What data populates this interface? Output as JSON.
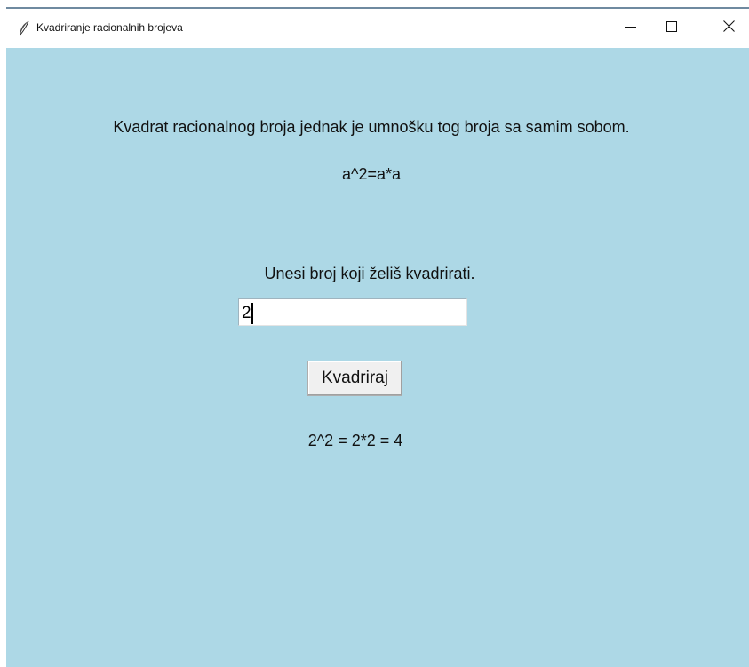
{
  "window": {
    "title": "Kvadriranje racionalnih brojeva",
    "icon": "feather-icon",
    "controls": [
      "minimize-icon",
      "maximize-icon",
      "close-icon"
    ],
    "background_color": "#add8e6"
  },
  "main": {
    "description": "Kvadrat racionalnog broja jednak je umnošku tog broja sa samim sobom.",
    "formula": "a^2=a*a",
    "input_prompt": "Unesi broj koji želiš kvadrirati.",
    "input_value": "2",
    "button_label": "Kvadriraj",
    "result": "2^2 = 2*2 = 4"
  }
}
